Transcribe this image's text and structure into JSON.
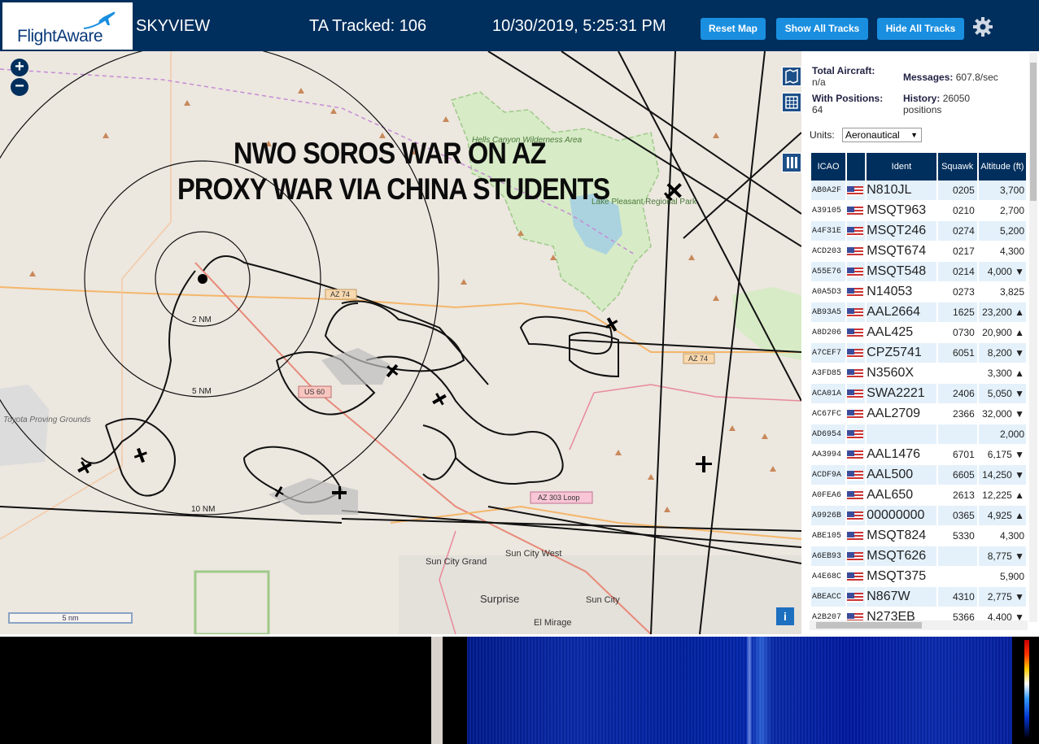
{
  "header": {
    "logo_text": "FlightAware",
    "app_name": "SKYVIEW",
    "ta_tracked": "TA Tracked: 106",
    "datetime": "10/30/2019, 5:25:31 PM",
    "buttons": {
      "reset_map": "Reset Map",
      "show_all_tracks": "Show All Tracks",
      "hide_all_tracks": "Hide All Tracks"
    },
    "settings_icon": "gear-icon"
  },
  "map": {
    "zoom_in": "+",
    "zoom_out": "−",
    "overlay_line1": "NWO SOROS WAR ON AZ",
    "overlay_line2": "PROXY WAR VIA CHINA STUDENTS",
    "range_labels": [
      "2 NM",
      "5 NM",
      "10 NM"
    ],
    "scale_label": "5 nm",
    "info_label": "i",
    "place_labels": {
      "lake_park": "Lake Pleasant Regional Park",
      "hills_wilderness": "Hells Canyon Wilderness Area",
      "toyota": "Toyota Proving Grounds",
      "sun_city_grand": "Sun City Grand",
      "sun_city_west": "Sun City West",
      "sun_city": "Sun City",
      "surprise": "Surprise",
      "el_mirage": "El Mirage"
    },
    "road_labels": {
      "az74_a": "AZ 74",
      "az74_b": "AZ 74",
      "us60": "US 60",
      "az303": "AZ 303 Loop"
    }
  },
  "panel": {
    "stats": {
      "total_aircraft_label": "Total Aircraft:",
      "total_aircraft_value": "n/a",
      "with_positions_label": "With Positions:",
      "with_positions_value": "64",
      "messages_label": "Messages:",
      "messages_value": "607.8/sec",
      "history_label": "History:",
      "history_value": "26050 positions"
    },
    "units_label": "Units:",
    "units_value": "Aeronautical",
    "columns": [
      "ICAO",
      "",
      "Ident",
      "Squawk",
      "Altitude (ft)"
    ],
    "rows": [
      {
        "icao": "AB0A2F",
        "ident": "N810JL",
        "squawk": "0205",
        "alt": "3,700"
      },
      {
        "icao": "A39105",
        "ident": "MSQT963",
        "squawk": "0210",
        "alt": "2,700"
      },
      {
        "icao": "A4F31E",
        "ident": "MSQT246",
        "squawk": "0274",
        "alt": "5,200"
      },
      {
        "icao": "ACD203",
        "ident": "MSQT674",
        "squawk": "0217",
        "alt": "4,300"
      },
      {
        "icao": "A55E76",
        "ident": "MSQT548",
        "squawk": "0214",
        "alt": "4,000 ▼"
      },
      {
        "icao": "A0A5D3",
        "ident": "N14053",
        "squawk": "0273",
        "alt": "3,825"
      },
      {
        "icao": "AB93A5",
        "ident": "AAL2664",
        "squawk": "1625",
        "alt": "23,200 ▲"
      },
      {
        "icao": "A8D206",
        "ident": "AAL425",
        "squawk": "0730",
        "alt": "20,900 ▲"
      },
      {
        "icao": "A7CEF7",
        "ident": "CPZ5741",
        "squawk": "6051",
        "alt": "8,200 ▼"
      },
      {
        "icao": "A3FD85",
        "ident": "N3560X",
        "squawk": "",
        "alt": "3,300 ▲"
      },
      {
        "icao": "ACA01A",
        "ident": "SWA2221",
        "squawk": "2406",
        "alt": "5,050 ▼"
      },
      {
        "icao": "AC67FC",
        "ident": "AAL2709",
        "squawk": "2366",
        "alt": "32,000 ▼"
      },
      {
        "icao": "AD6954",
        "ident": "",
        "squawk": "",
        "alt": "2,000"
      },
      {
        "icao": "AA3994",
        "ident": "AAL1476",
        "squawk": "6701",
        "alt": "6,175 ▼"
      },
      {
        "icao": "ACDF9A",
        "ident": "AAL500",
        "squawk": "6605",
        "alt": "14,250 ▼"
      },
      {
        "icao": "A0FEA6",
        "ident": "AAL650",
        "squawk": "2613",
        "alt": "12,225 ▲"
      },
      {
        "icao": "A9926B",
        "ident": "00000000",
        "squawk": "0365",
        "alt": "4,925 ▲"
      },
      {
        "icao": "ABE105",
        "ident": "MSQT824",
        "squawk": "5330",
        "alt": "4,300"
      },
      {
        "icao": "A6EB93",
        "ident": "MSQT626",
        "squawk": "",
        "alt": "8,775 ▼"
      },
      {
        "icao": "A4E68C",
        "ident": "MSQT375",
        "squawk": "",
        "alt": "5,900"
      },
      {
        "icao": "ABEACC",
        "ident": "N867W",
        "squawk": "4310",
        "alt": "2,775 ▼"
      },
      {
        "icao": "A2B207",
        "ident": "N273EB",
        "squawk": "5366",
        "alt": "4,400 ▼"
      }
    ]
  },
  "colors": {
    "header_bg": "#002f5d",
    "button_bg": "#1a8fe0",
    "map_bg": "#ece7df"
  }
}
